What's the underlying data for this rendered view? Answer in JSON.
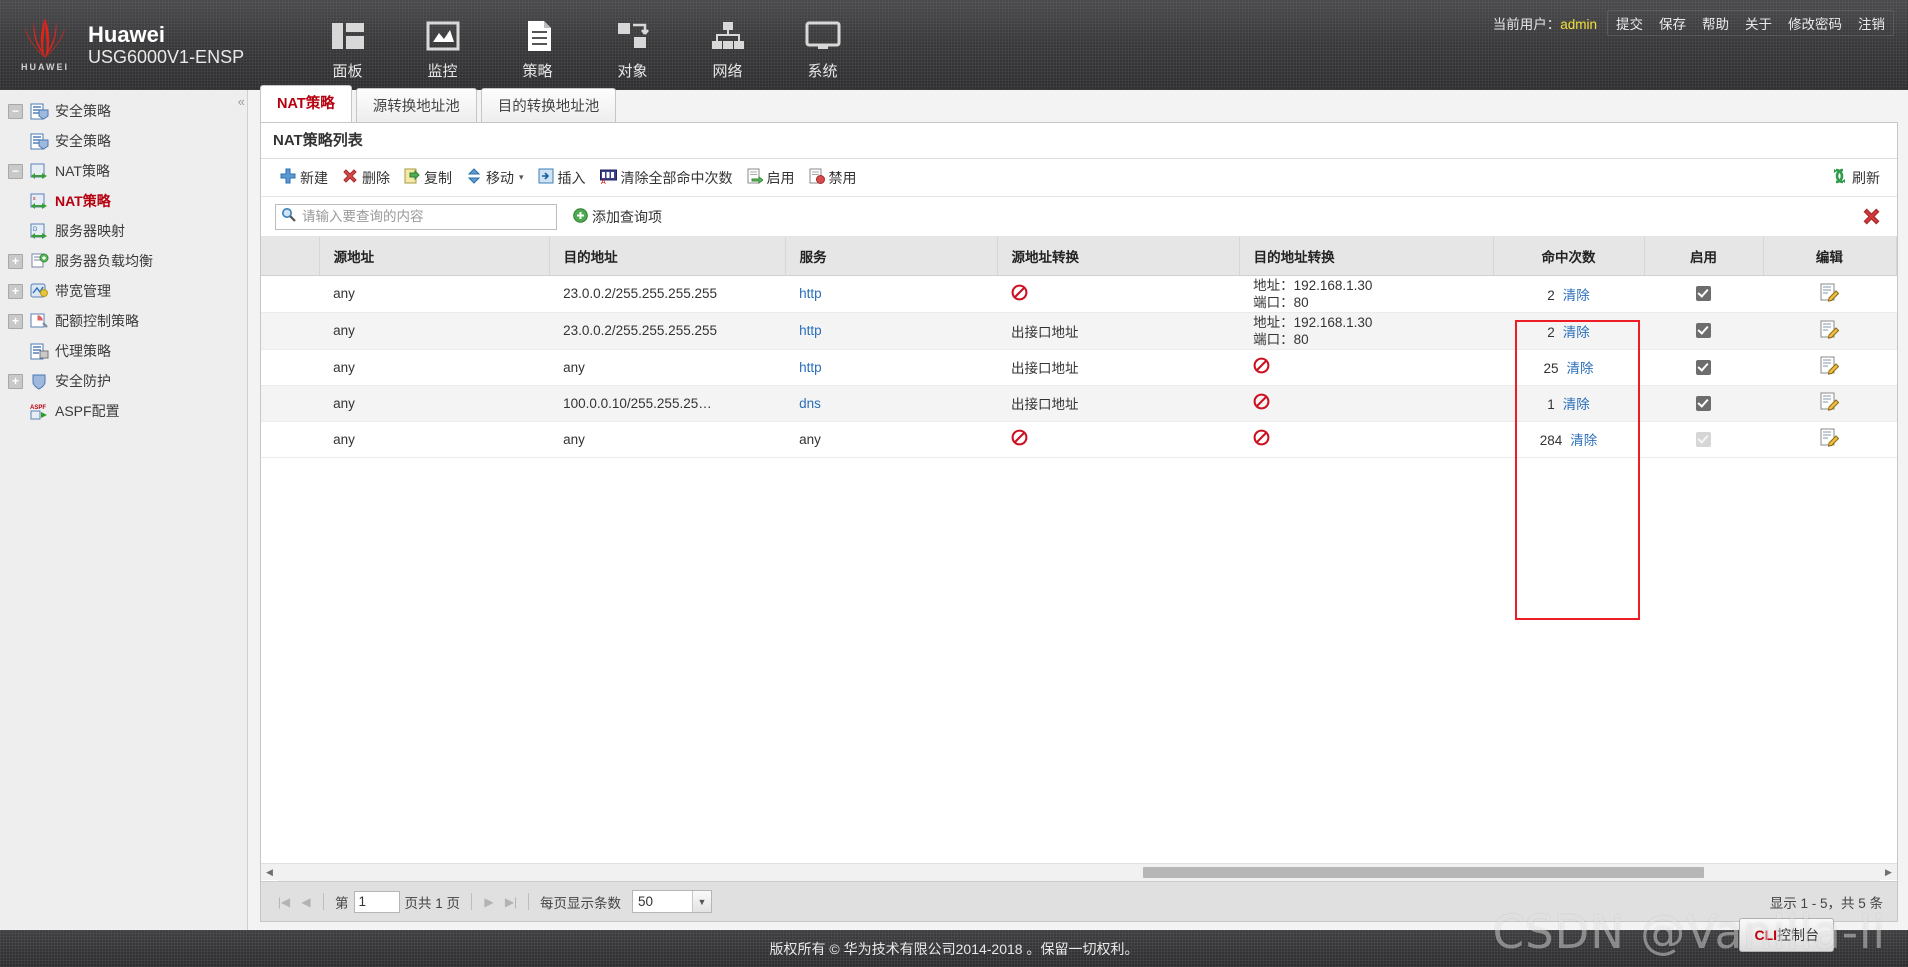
{
  "header": {
    "brand_name": "Huawei",
    "brand_model": "USG6000V1-ENSP",
    "logo_text": "HUAWEI",
    "nav": [
      {
        "label": "面板",
        "icon": "panel-icon"
      },
      {
        "label": "监控",
        "icon": "monitor-icon"
      },
      {
        "label": "策略",
        "icon": "policy-icon"
      },
      {
        "label": "对象",
        "icon": "object-icon"
      },
      {
        "label": "网络",
        "icon": "network-icon"
      },
      {
        "label": "系统",
        "icon": "system-icon"
      }
    ],
    "current_user_label": "当前用户：",
    "current_user": "admin",
    "links": [
      "提交",
      "保存",
      "帮助",
      "关于",
      "修改密码",
      "注销"
    ]
  },
  "sidebar": {
    "collapse_glyph": "«",
    "items": [
      {
        "label": "安全策略",
        "toggle": "−",
        "level": 0,
        "icon": "security-policy-icon",
        "active": false
      },
      {
        "label": "安全策略",
        "toggle": "",
        "level": 1,
        "icon": "security-policy-icon",
        "active": false
      },
      {
        "label": "NAT策略",
        "toggle": "−",
        "level": 0,
        "icon": "nat-policy-icon",
        "active": false
      },
      {
        "label": "NAT策略",
        "toggle": "",
        "level": 1,
        "icon": "nat-policy-icon",
        "active": true
      },
      {
        "label": "服务器映射",
        "toggle": "",
        "level": 1,
        "icon": "server-map-icon",
        "active": false
      },
      {
        "label": "服务器负载均衡",
        "toggle": "+",
        "level": 0,
        "icon": "load-balance-icon",
        "active": false
      },
      {
        "label": "带宽管理",
        "toggle": "+",
        "level": 0,
        "icon": "bandwidth-icon",
        "active": false
      },
      {
        "label": "配额控制策略",
        "toggle": "+",
        "level": 0,
        "icon": "quota-icon",
        "active": false
      },
      {
        "label": "代理策略",
        "toggle": "",
        "level": 0,
        "icon": "proxy-icon",
        "active": false
      },
      {
        "label": "安全防护",
        "toggle": "+",
        "level": 0,
        "icon": "shield-icon",
        "active": false
      },
      {
        "label": "ASPF配置",
        "toggle": "",
        "level": 0,
        "icon": "aspf-icon",
        "active": false
      }
    ]
  },
  "main": {
    "tabs": [
      {
        "label": "NAT策略",
        "active": true
      },
      {
        "label": "源转换地址池",
        "active": false
      },
      {
        "label": "目的转换地址池",
        "active": false
      }
    ],
    "panel_title": "NAT策略列表",
    "toolbar": [
      {
        "label": "新建",
        "icon": "plus-icon"
      },
      {
        "label": "删除",
        "icon": "delete-x-icon"
      },
      {
        "label": "复制",
        "icon": "copy-icon"
      },
      {
        "label": "移动",
        "icon": "move-icon",
        "caret": "▾"
      },
      {
        "label": "插入",
        "icon": "insert-icon"
      },
      {
        "label": "清除全部命中次数",
        "icon": "counter-icon"
      },
      {
        "label": "启用",
        "icon": "enable-icon"
      },
      {
        "label": "禁用",
        "icon": "disable-icon"
      }
    ],
    "refresh_label": "刷新",
    "search": {
      "placeholder": "请输入要查询的内容",
      "value": ""
    },
    "add_query_label": "添加查询项",
    "close_filter_glyph": "✖",
    "columns": [
      "源地址",
      "目的地址",
      "服务",
      "源地址转换",
      "目的地址转换",
      "命中次数",
      "启用",
      "编辑"
    ],
    "rows": [
      {
        "src": "any",
        "dst": "23.0.0.2/255.255.255.255",
        "service": "http",
        "src_nat": "deny",
        "dst_nat_address_label": "地址：",
        "dst_nat_address": "192.168.1.30",
        "dst_nat_port_label": "端口：",
        "dst_nat_port": "80",
        "hits": "2",
        "clear_label": "清除",
        "enabled": true,
        "enabled_disabled": false
      },
      {
        "src": "any",
        "dst": "23.0.0.2/255.255.255.255",
        "service": "http",
        "src_nat": "出接口地址",
        "dst_nat_address_label": "地址：",
        "dst_nat_address": "192.168.1.30",
        "dst_nat_port_label": "端口：",
        "dst_nat_port": "80",
        "hits": "2",
        "clear_label": "清除",
        "enabled": true,
        "enabled_disabled": false
      },
      {
        "src": "any",
        "dst": "any",
        "service": "http",
        "src_nat": "出接口地址",
        "dst_nat": "deny",
        "hits": "25",
        "clear_label": "清除",
        "enabled": true,
        "enabled_disabled": false
      },
      {
        "src": "any",
        "dst": "100.0.0.10/255.255.25…",
        "service": "dns",
        "src_nat": "出接口地址",
        "dst_nat": "deny",
        "hits": "1",
        "clear_label": "清除",
        "enabled": true,
        "enabled_disabled": false
      },
      {
        "src": "any",
        "dst": "any",
        "service": "any",
        "src_nat": "deny",
        "dst_nat": "deny",
        "hits": "284",
        "clear_label": "清除",
        "enabled": true,
        "enabled_disabled": true
      }
    ],
    "pager": {
      "first_glyph": "|◀",
      "prev_glyph": "◀",
      "page_prefix": "第",
      "page_value": "1",
      "page_suffix": "页共 1 页",
      "next_glyph": "▶",
      "last_glyph": "▶|",
      "per_page_label": "每页显示条数",
      "per_page_value": "50",
      "select_caret": "▼",
      "summary": "显示 1 - 5，共 5 条"
    }
  },
  "cli_button": {
    "prefix": "CLI",
    "label": "控制台"
  },
  "footer": {
    "copyright": "版权所有 © 华为技术有限公司2014-2018 。保留一切权利。"
  },
  "watermark": "CSDN @Vanilla-li"
}
